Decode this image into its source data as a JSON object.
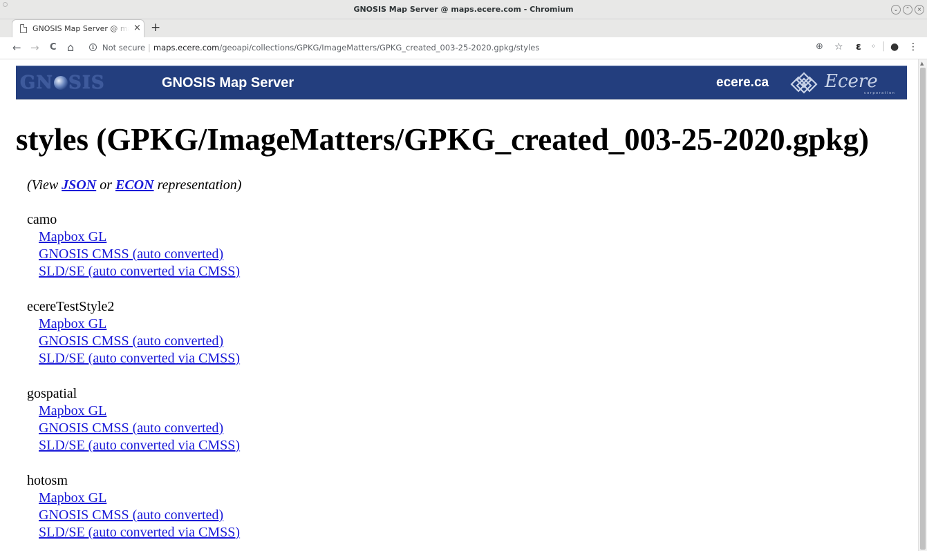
{
  "window": {
    "title": "GNOSIS Map Server @ maps.ecere.com - Chromium"
  },
  "tab": {
    "title": "GNOSIS Map Server @ maps.ecere.com",
    "close_glyph": "×",
    "new_tab_glyph": "+"
  },
  "toolbar": {
    "back_glyph": "←",
    "forward_glyph": "→",
    "reload_glyph": "C",
    "home_glyph": "⌂",
    "security_label": "Not secure",
    "url_host": "maps.ecere.com",
    "url_path": "/geoapi/collections/GPKG/ImageMatters/GPKG_created_003-25-2020.gpkg/styles",
    "zoom_glyph": "⊕",
    "star_glyph": "☆",
    "ext1_glyph": "ɛ",
    "ext2_glyph": "◦",
    "account_glyph": "●",
    "menu_glyph": "⋮"
  },
  "banner": {
    "logo_left": "GN",
    "logo_right": "SIS",
    "title": "GNOSIS Map Server",
    "link": "ecere.ca",
    "brand_word": "Ecere",
    "brand_sub": "corporation"
  },
  "heading": "styles (GPKG/ImageMatters/GPKG_created_003-25-2020.gpkg)",
  "representation": {
    "prefix": "(View ",
    "json_label": "JSON",
    "middle": " or ",
    "econ_label": "ECON",
    "suffix": " representation)"
  },
  "styles": [
    {
      "name": "camo",
      "links": [
        "Mapbox GL",
        "GNOSIS CMSS (auto converted)",
        "SLD/SE (auto converted via CMSS)"
      ]
    },
    {
      "name": "ecereTestStyle2",
      "links": [
        "Mapbox GL",
        "GNOSIS CMSS (auto converted)",
        "SLD/SE (auto converted via CMSS)"
      ]
    },
    {
      "name": "gospatial",
      "links": [
        "Mapbox GL",
        "GNOSIS CMSS (auto converted)",
        "SLD/SE (auto converted via CMSS)"
      ]
    },
    {
      "name": "hotosm",
      "links": [
        "Mapbox GL",
        "GNOSIS CMSS (auto converted)",
        "SLD/SE (auto converted via CMSS)"
      ]
    }
  ],
  "colors": {
    "banner_bg": "#233e7e",
    "link": "#1a1ad8"
  }
}
